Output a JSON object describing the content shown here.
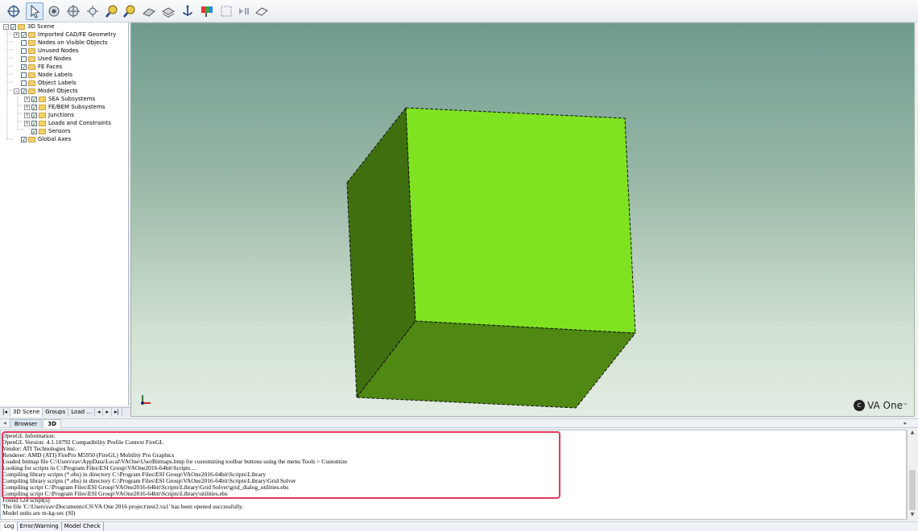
{
  "toolbar": {
    "buttons": [
      {
        "icon": "pan-icon"
      },
      {
        "icon": "select-arrow-icon",
        "active": true
      },
      {
        "icon": "rotate-icon"
      },
      {
        "icon": "rotate-3d-icon"
      },
      {
        "icon": "spin-icon"
      },
      {
        "icon": "zoom-in-icon"
      },
      {
        "icon": "zoom-out-icon"
      },
      {
        "icon": "plane-icon"
      },
      {
        "icon": "layers-icon"
      },
      {
        "icon": "anchor-icon"
      },
      {
        "icon": "color-map-icon"
      },
      {
        "icon": "grid-icon"
      },
      {
        "icon": "play-pause-icon"
      },
      {
        "icon": "eraser-icon"
      }
    ]
  },
  "tree": {
    "items": [
      {
        "label": "3D Scene",
        "checked": true
      },
      {
        "label": "Imported CAD/FE Geometry",
        "checked": true
      },
      {
        "label": "Nodes on Visible Objects",
        "checked": false
      },
      {
        "label": "Unused Nodes",
        "checked": false
      },
      {
        "label": "Used Nodes",
        "checked": false
      },
      {
        "label": "FE Faces",
        "checked": true
      },
      {
        "label": "Node Labels",
        "checked": false
      },
      {
        "label": "Object Labels",
        "checked": false
      },
      {
        "label": "Model Objects",
        "checked": true
      },
      {
        "label": "SEA Subsystems",
        "checked": true
      },
      {
        "label": "FE/BEM Subsystems",
        "checked": true
      },
      {
        "label": "Junctions",
        "checked": true
      },
      {
        "label": "Loads and Constraints",
        "checked": true
      },
      {
        "label": "Sensors",
        "checked": true
      },
      {
        "label": "Global Axes",
        "checked": true
      }
    ],
    "tabs": [
      "3D Scene",
      "Groups",
      "Load ..."
    ]
  },
  "view_tabs": [
    "Browser",
    "3D"
  ],
  "logo": {
    "text": "VA One",
    "tm": "™"
  },
  "log": {
    "lines": [
      "OpenGL Information:",
      "OpenGL Version: 4.1.10792 Compatibility Profile Context FireGL",
      "Vendor: ATI Technologies Inc.",
      "Renderer: AMD (ATI) FirePro M5950 (FireGL) Mobility Pro Graphics",
      "Loaded bitmap file C:\\Users\\rav\\AppData\\Local\\VAOne\\UserBitmaps.bmp for customizing toolbar buttons using the menu Tools > Customize",
      "Looking for scripts in C:\\Program Files\\ESI Group\\VAOne2016-64bit\\Scripts ...",
      "Compiling library scripts (*.ebs) in directory C:\\Program Files\\ESI Group\\VAOne2016-64bit\\Scripts\\Library",
      "Compiling library scripts (*.ebs) in directory C:\\Program Files\\ESI Group\\VAOne2016-64bit\\Scripts\\Library\\Grid Solver",
      "Compiling script C:\\Program Files\\ESI Group\\VAOne2016-64bit\\Scripts\\Library\\Grid Solver\\grid_dialog_utilities.ebs",
      "Compiling script C:\\Program Files\\ESI Group\\VAOne2016-64bit\\Scripts\\Library\\utilities.ebs",
      "Found 124 script(s)",
      "The file 'C:\\Users\\rav\\Documents\\CS\\VA One 2016 project\\test2.va1' has been opened successfully.",
      "Model units are m-kg-sec (SI)"
    ]
  },
  "bottom_tabs": [
    "Log",
    "Error/Warning",
    "Model Check"
  ],
  "colors": {
    "cube_front": "#7fe322",
    "cube_side": "#3f6f0f",
    "cube_bottom": "#4f8812",
    "highlight": "#e0395b"
  }
}
